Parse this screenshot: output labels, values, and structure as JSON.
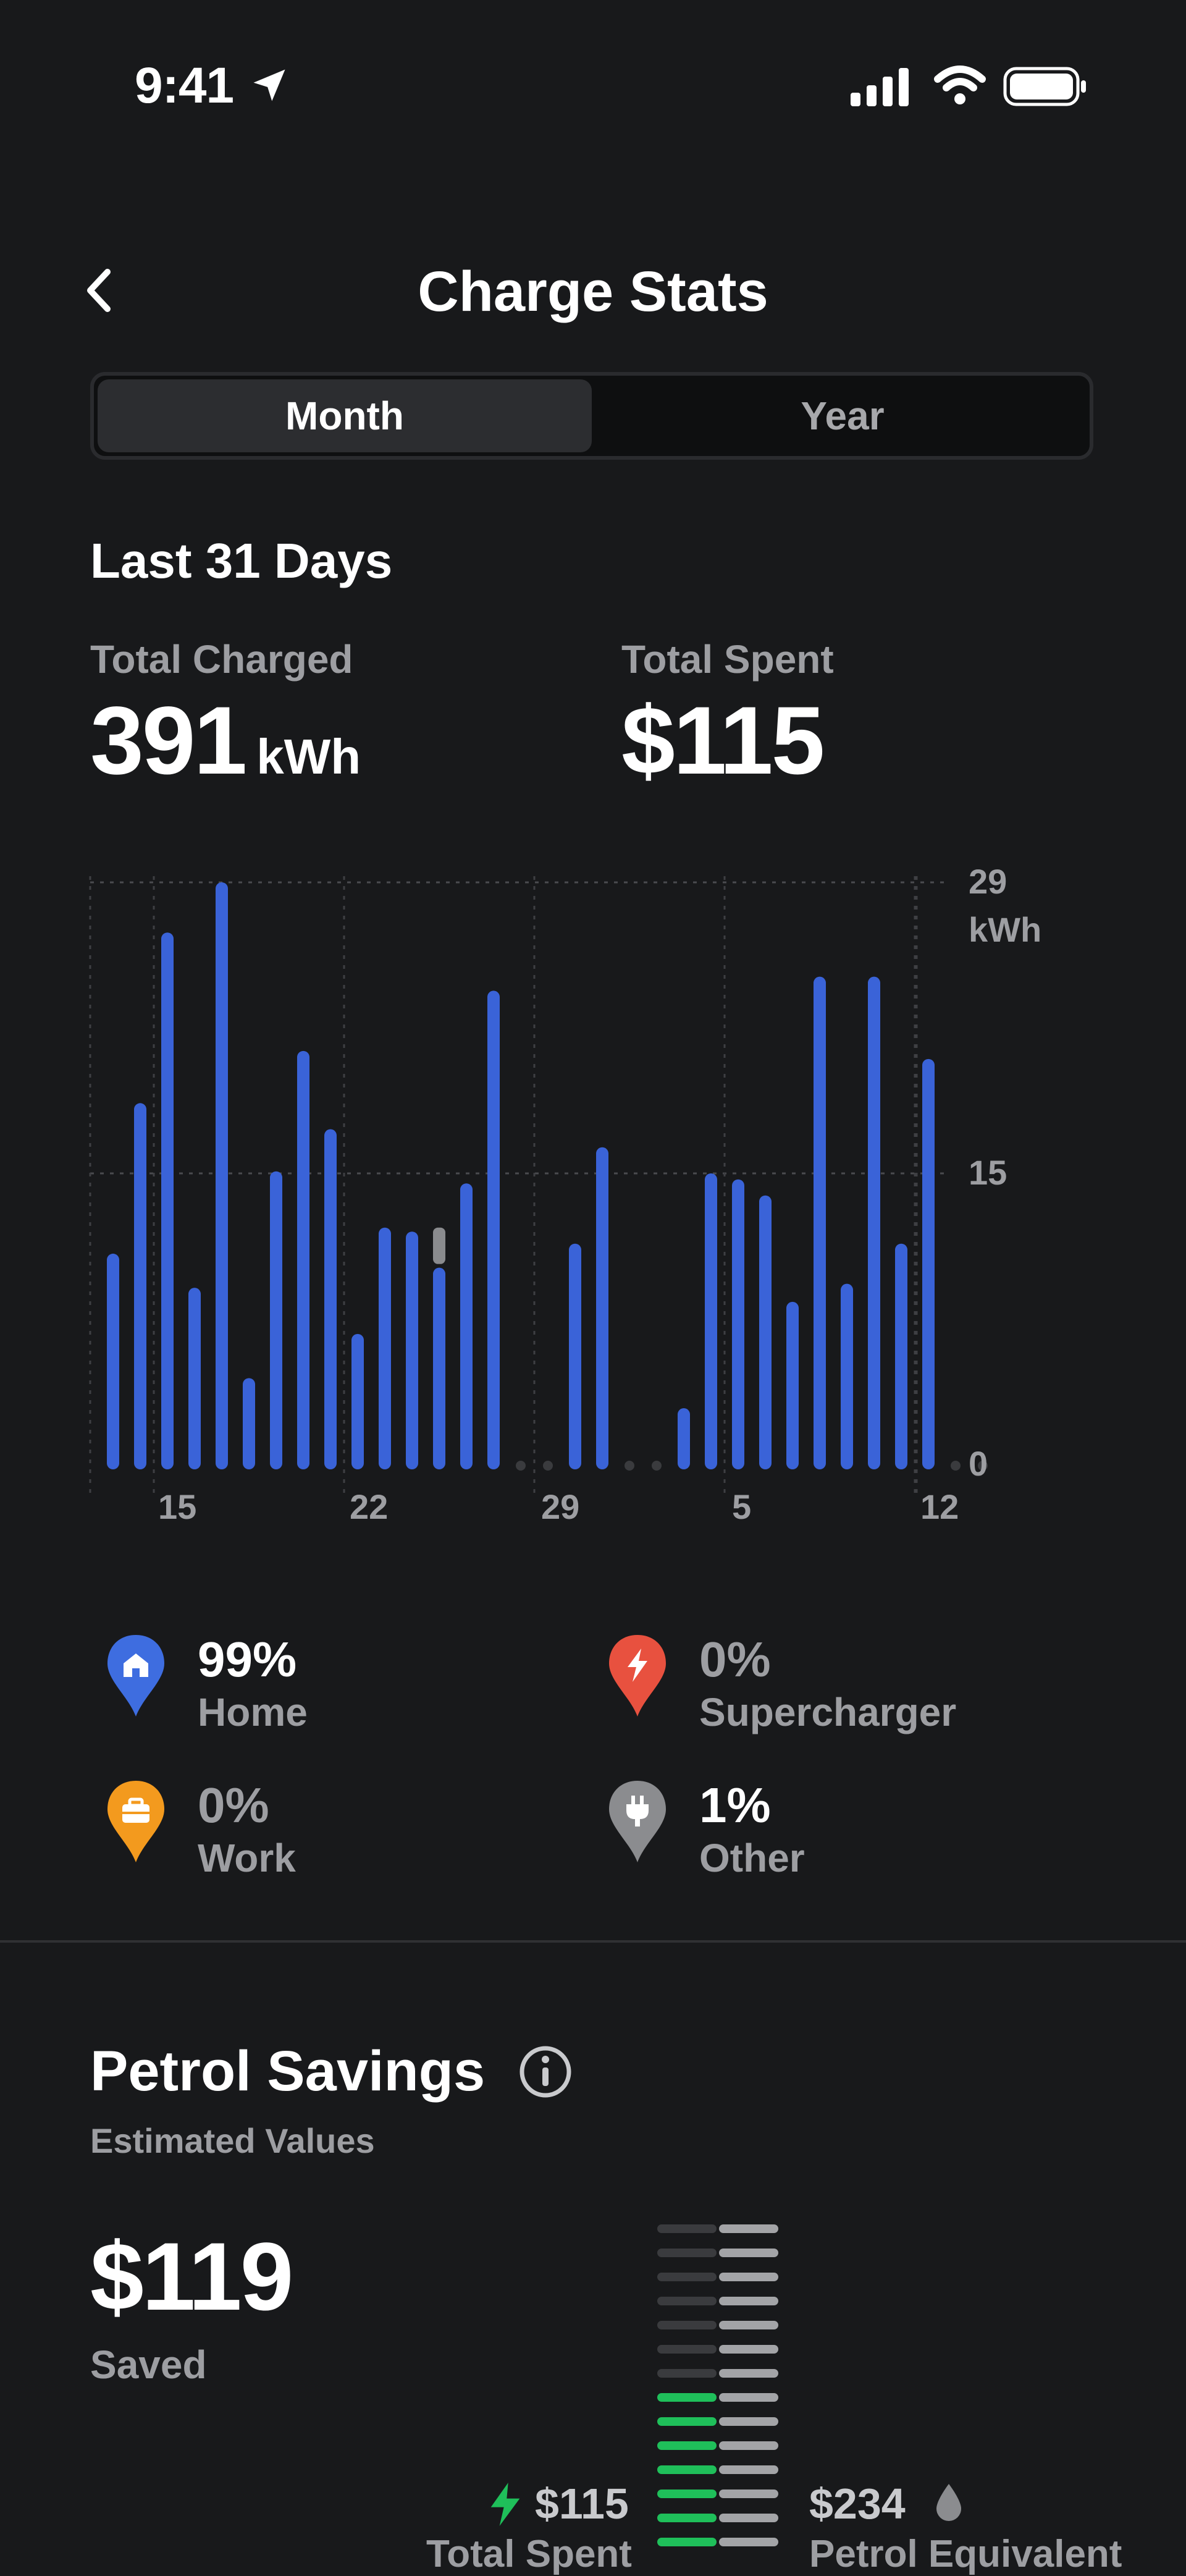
{
  "status_bar": {
    "time": "9:41"
  },
  "header": {
    "title": "Charge Stats"
  },
  "tabs": [
    {
      "label": "Month",
      "selected": true
    },
    {
      "label": "Year",
      "selected": false
    }
  ],
  "period_label": "Last 31 Days",
  "stats": {
    "charged_label": "Total Charged",
    "charged_value": "391",
    "charged_unit": "kWh",
    "spent_label": "Total Spent",
    "spent_value": "$115"
  },
  "chart_data": {
    "type": "bar",
    "y_unit": "kWh",
    "ylim": [
      0,
      29
    ],
    "y_ticks": [
      "29",
      "15",
      "0"
    ],
    "x_tick_labels": [
      "15",
      "22",
      "29",
      "5",
      "12"
    ],
    "grid": true,
    "series": [
      {
        "color": "#3a63d8",
        "values": [
          10.5,
          18,
          26.5,
          8.8,
          29,
          4.3,
          14.6,
          20.6,
          16.7,
          6.5,
          11.8,
          11.6,
          9.8,
          14,
          23.6,
          0,
          0,
          11,
          15.8,
          0,
          0,
          2.8,
          14.5,
          14.2,
          13.4,
          8.1,
          24.3,
          9,
          24.3,
          11,
          20.2,
          0,
          0
        ]
      },
      {
        "color": "#8a8b8e",
        "values": [
          0,
          0,
          0,
          0,
          0,
          0,
          0,
          0,
          0,
          0,
          0,
          0,
          2,
          0,
          0,
          0,
          0,
          0,
          0,
          0,
          0,
          0,
          0,
          0,
          0,
          0,
          0,
          0,
          0,
          0,
          0,
          0,
          0
        ]
      }
    ]
  },
  "legend": [
    {
      "pct": "99%",
      "name": "Home",
      "color": "#3e6de0",
      "icon": "home-icon"
    },
    {
      "pct": "0%",
      "name": "Supercharger",
      "color": "#e8513f",
      "icon": "bolt-icon"
    },
    {
      "pct": "0%",
      "name": "Work",
      "color": "#f39a1e",
      "icon": "briefcase-icon"
    },
    {
      "pct": "1%",
      "name": "Other",
      "color": "#8b8c8f",
      "icon": "plug-icon"
    }
  ],
  "petrol": {
    "title": "Petrol Savings",
    "subtitle": "Estimated Values",
    "saved_value": "$119",
    "saved_label": "Saved",
    "spent_value": "$115",
    "spent_label": "Total Spent",
    "petrol_value": "$234",
    "petrol_label": "Petrol Equivalent",
    "accent": "#1fbf5a"
  }
}
